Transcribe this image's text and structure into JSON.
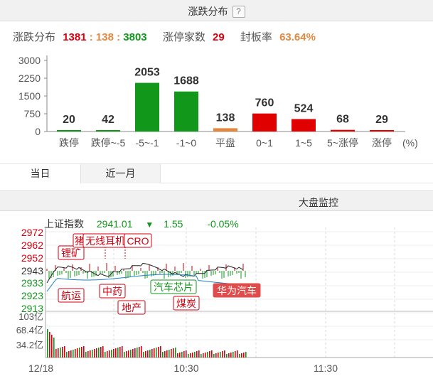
{
  "top_panel": {
    "title": "涨跌分布",
    "help_label": "?",
    "stats": {
      "dist_label": "涨跌分布",
      "up": "1381",
      "sep1": ":",
      "flat": "138",
      "sep2": ":",
      "down": "3803",
      "limit_label": "涨停家数",
      "limit_count": "29",
      "seal_label": "封板率",
      "seal_rate": "63.64%"
    },
    "tabs": [
      {
        "label": "当日",
        "active": true
      },
      {
        "label": "近一月",
        "active": false
      }
    ]
  },
  "chart_data": {
    "type": "bar",
    "categories": [
      "跌停",
      "跌停~-5",
      "-5~-1",
      "-1~0",
      "平盘",
      "0~1",
      "1~5",
      "5~涨停",
      "涨停"
    ],
    "values": [
      20,
      42,
      2053,
      1688,
      138,
      760,
      524,
      68,
      29
    ],
    "colors": [
      "#11981b",
      "#11981b",
      "#11981b",
      "#11981b",
      "#e4873f",
      "#e00000",
      "#e00000",
      "#e00000",
      "#e00000"
    ],
    "yticks": [
      0,
      750,
      1500,
      2250,
      3000
    ],
    "ylim": [
      0,
      3000
    ],
    "unit_label": "(%)"
  },
  "bottom_panel": {
    "title": "大盘监控",
    "index": {
      "name": "上证指数",
      "value": "2941.01",
      "arrow": "▼",
      "change": "1.55",
      "pct": "-0.05%"
    },
    "price_ticks": [
      "2972",
      "2962",
      "2952",
      "2943",
      "2933",
      "2923",
      "2913"
    ],
    "volume_ticks": [
      "103亿",
      "68.4亿",
      "34.2亿"
    ],
    "time_ticks": [
      "12/18",
      "10:30",
      "11:30"
    ],
    "sector_tags": [
      "锂矿",
      "猪",
      "无线耳机",
      "CRO",
      "航运",
      "中药",
      "地产",
      "汽车芯片",
      "煤炭",
      "华为汽车"
    ]
  }
}
